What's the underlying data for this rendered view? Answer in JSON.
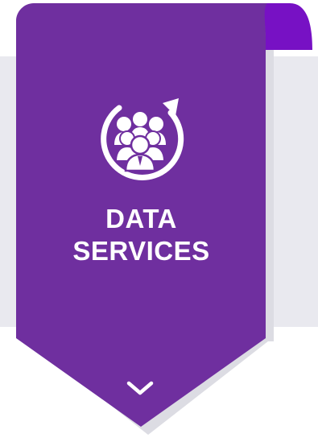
{
  "card": {
    "title_line1": "DATA",
    "title_line2": "SERVICES",
    "icon": "team-cycle-icon",
    "expand_icon": "chevron-down-icon"
  },
  "colors": {
    "card_purple": "#6f2f9f",
    "fold_purple": "#7711c4",
    "fold_shadow": "#dcdce3",
    "backdrop": "#e9e9ef",
    "text": "#ffffff",
    "card_shadow": "#d8d8e0"
  }
}
